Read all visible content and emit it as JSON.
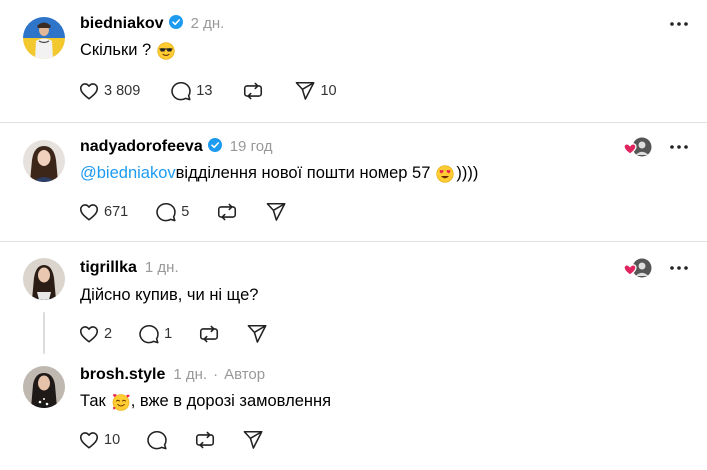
{
  "posts": [
    {
      "username": "biedniakov",
      "verified": true,
      "time": "2 дн.",
      "text": "Скільки ?",
      "emoji": "sunglasses",
      "likes": "3 809",
      "comments": "13",
      "shares": "10"
    },
    {
      "username": "nadyadorofeeva",
      "verified": true,
      "time": "19 год",
      "mention": "@biedniakov",
      "text": " відділення нової пошти номер 57",
      "emoji": "heart-eyes",
      "suffix": "))))",
      "likes": "671",
      "comments": "5"
    },
    {
      "username": "tigrillka",
      "time": "1 дн.",
      "text": "Дійсно купив, чи ні ще?",
      "likes": "2",
      "comments": "1"
    },
    {
      "username": "brosh.style",
      "time": "1 дн.",
      "author_label": "Автор",
      "text_before": "Так",
      "emoji": "smiling-hearts",
      "text_after": ", вже в дорозі замовлення",
      "likes": "10"
    }
  ],
  "colors": {
    "accent": "#1d9bf0",
    "muted": "#999999",
    "like_heart": "#e0245e"
  },
  "icons": [
    "heart-icon",
    "comment-icon",
    "repost-icon",
    "share-icon",
    "more-icon",
    "verified-icon"
  ]
}
